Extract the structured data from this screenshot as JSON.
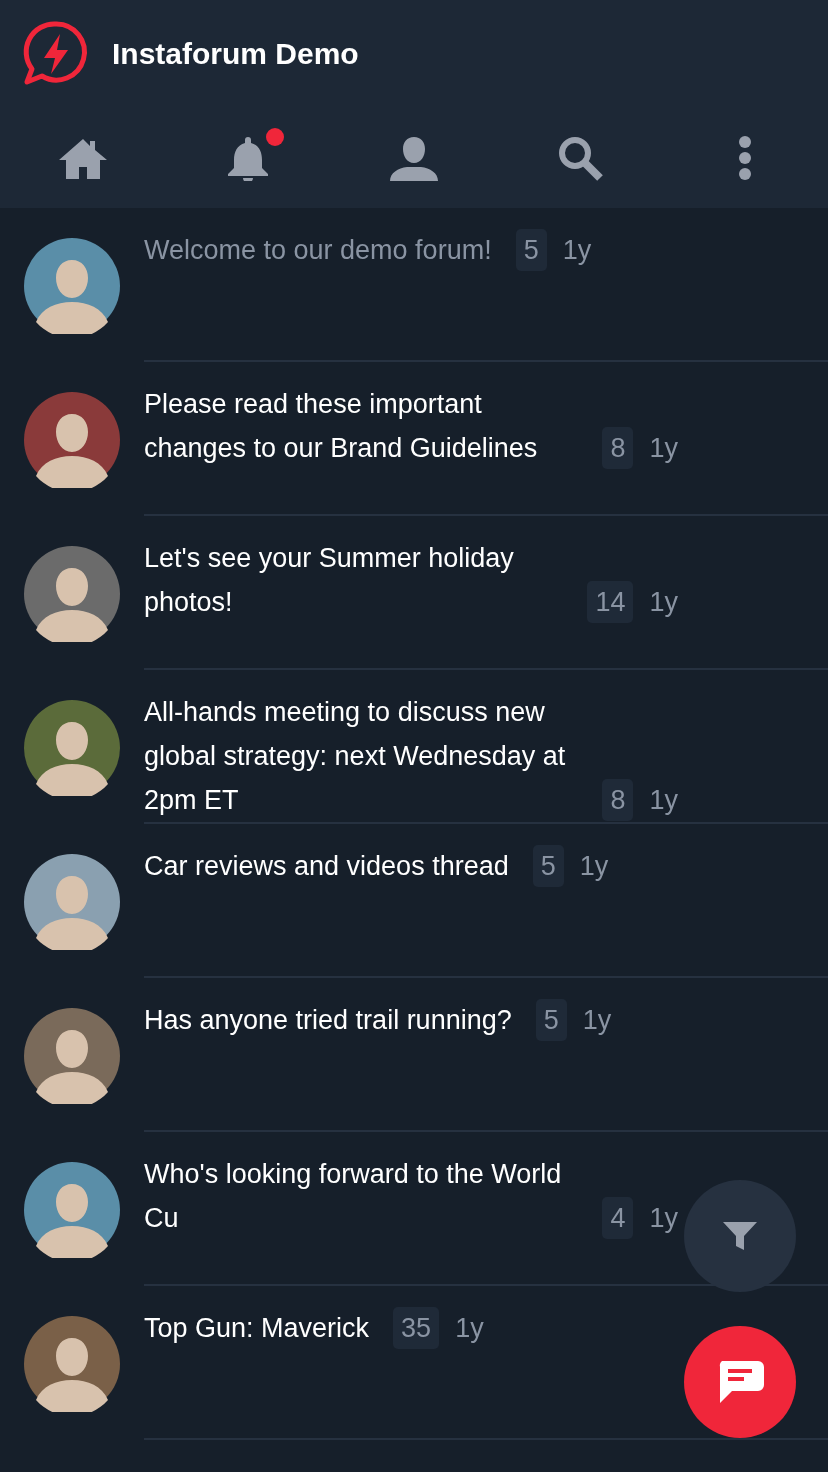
{
  "app": {
    "title": "Instaforum Demo"
  },
  "nav": [
    {
      "kind": "home",
      "badge": false
    },
    {
      "kind": "bell",
      "badge": true
    },
    {
      "kind": "user",
      "badge": false
    },
    {
      "kind": "search",
      "badge": false
    },
    {
      "kind": "more",
      "badge": false
    }
  ],
  "topics": [
    {
      "title": "Welcome to our demo forum!",
      "count": "5",
      "age": "1y",
      "read": true
    },
    {
      "title": "Please read these important changes to our Brand Guidelines",
      "count": "8",
      "age": "1y",
      "read": false
    },
    {
      "title": "Let's see your Summer holiday photos!",
      "count": "14",
      "age": "1y",
      "read": false
    },
    {
      "title": "All-hands meeting to discuss new global strategy: next Wednesday at 2pm ET",
      "count": "8",
      "age": "1y",
      "read": false
    },
    {
      "title": "Car reviews and videos thread",
      "count": "5",
      "age": "1y",
      "read": false
    },
    {
      "title": "Has anyone tried trail running?",
      "count": "5",
      "age": "1y",
      "read": false
    },
    {
      "title": "Who's looking forward to the World Cu",
      "count": "4",
      "age": "1y",
      "read": false
    },
    {
      "title": "Top Gun: Maverick",
      "count": "35",
      "age": "1y",
      "read": false
    }
  ]
}
